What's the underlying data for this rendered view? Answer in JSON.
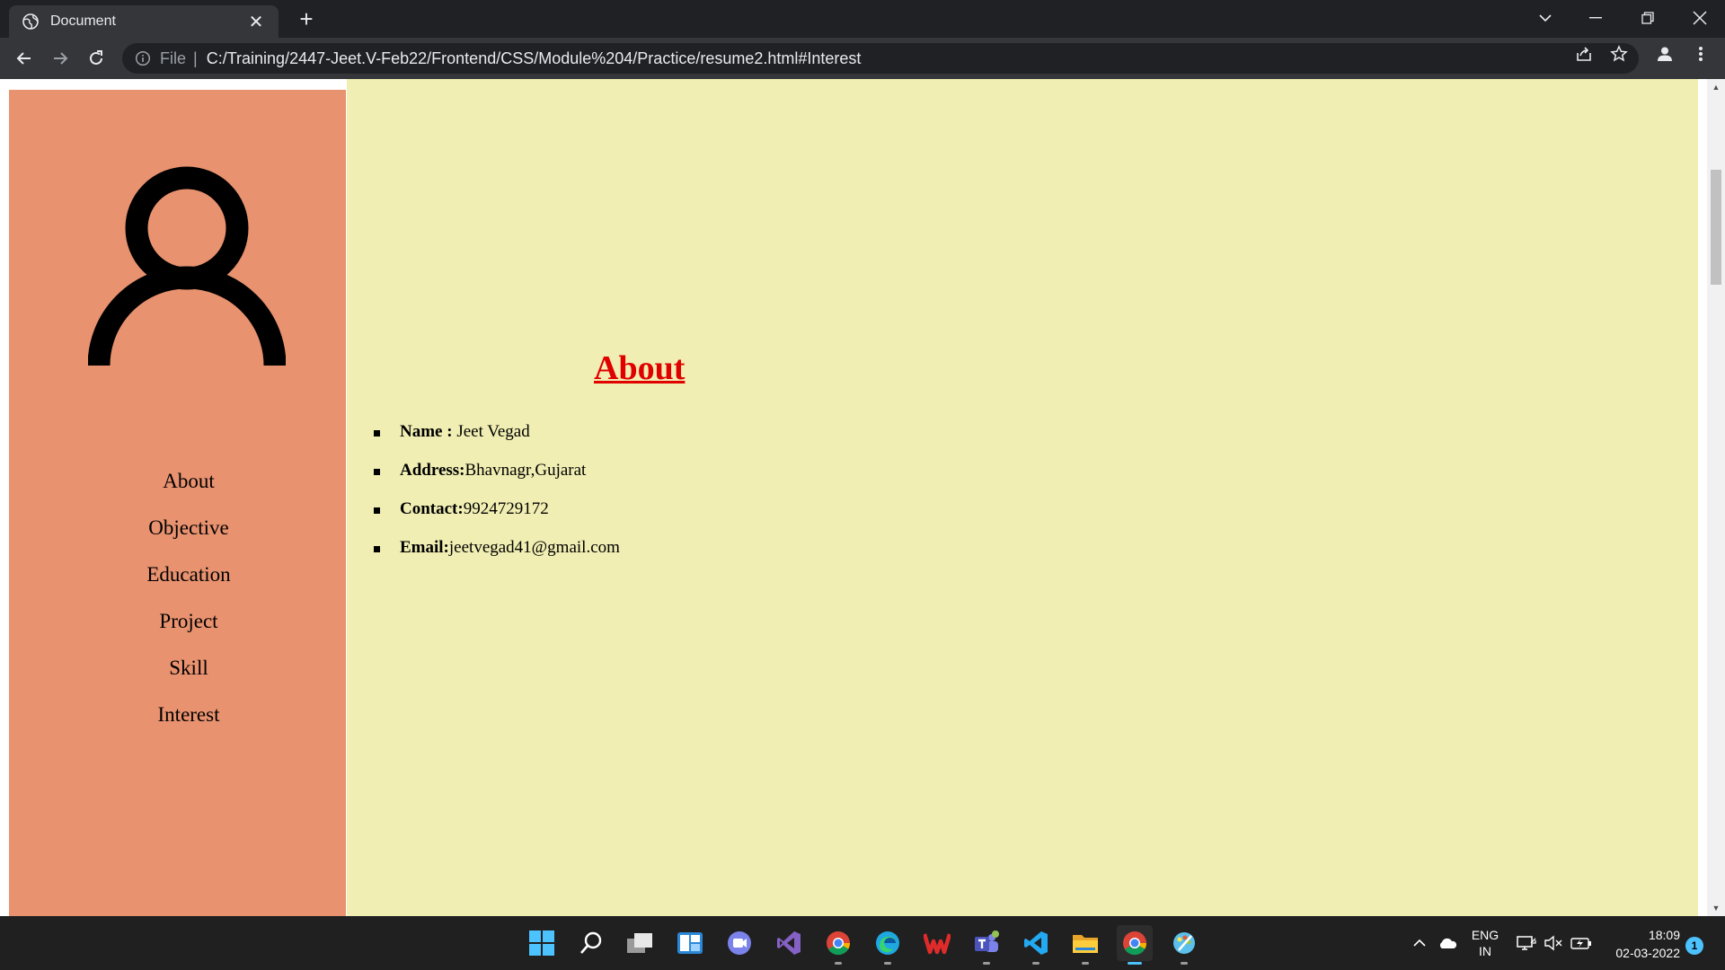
{
  "browser": {
    "tab_title": "Document",
    "tab_close_glyph": "✕",
    "new_tab_glyph": "+",
    "url_scheme": "File",
    "url_separator": "|",
    "url": "C:/Training/2447-Jeet.V-Feb22/Frontend/CSS/Module%204/Practice/resume2.html#Interest"
  },
  "sidebar": {
    "menu": [
      "About",
      "Objective",
      "Education",
      "Project",
      "Skill",
      "Interest"
    ]
  },
  "main": {
    "heading": "About",
    "details": [
      {
        "label": "Name : ",
        "value": "Jeet Vegad"
      },
      {
        "label": "Address:",
        "value": "Bhavnagr,Gujarat"
      },
      {
        "label": "Contact:",
        "value": "9924729172"
      },
      {
        "label": "Email:",
        "value": "jeetvegad41@gmail.com"
      }
    ]
  },
  "colors": {
    "sidebar_bg": "#e9926f",
    "main_bg": "#f0eeb2",
    "heading": "#e00000"
  },
  "taskbar": {
    "apps": [
      "start-icon",
      "search-icon",
      "task-view-icon",
      "widgets-icon",
      "chat-icon",
      "visual-studio-icon",
      "chrome-icon",
      "edge-icon",
      "wps-office-icon",
      "teams-icon",
      "vscode-icon",
      "file-explorer-icon",
      "chrome-active-icon",
      "paint-icon"
    ],
    "lang_line1": "ENG",
    "lang_line2": "IN",
    "time": "18:09",
    "date": "02-03-2022",
    "notification_count": "1"
  }
}
